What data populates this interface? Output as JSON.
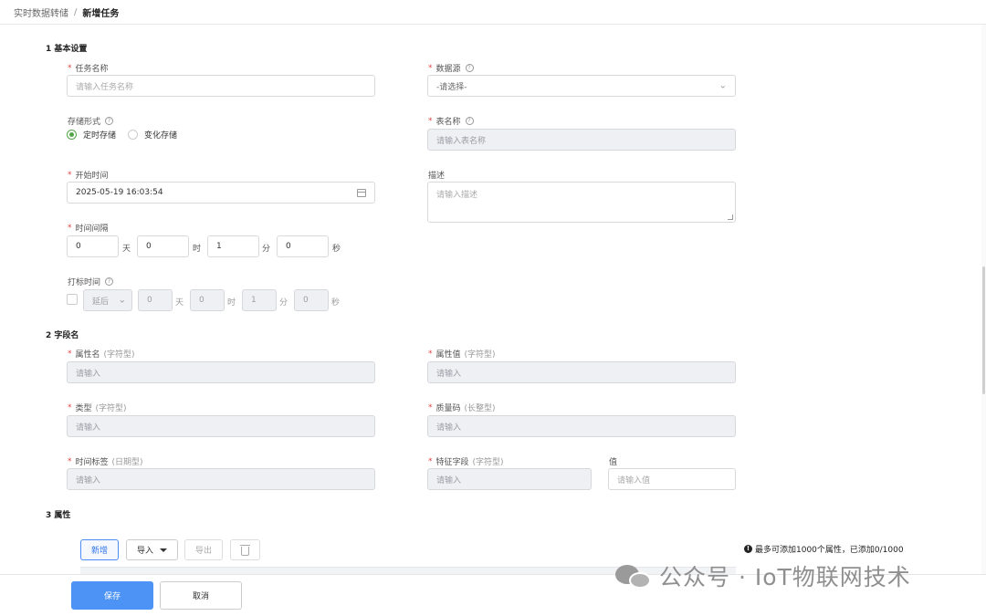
{
  "breadcrumb": {
    "parent": "实时数据转储",
    "separator": "/",
    "current": "新增任务"
  },
  "sections": {
    "basic": "1 基本设置",
    "fields": "2 字段名",
    "attributes": "3 属性"
  },
  "basic": {
    "task_name": {
      "label": "任务名称",
      "placeholder": "请输入任务名称"
    },
    "data_source": {
      "label": "数据源",
      "value": "-请选择-"
    },
    "storage_mode": {
      "label": "存储形式",
      "options": [
        "定时存储",
        "变化存储"
      ],
      "selected": "定时存储"
    },
    "table_name": {
      "label": "表名称",
      "placeholder": "请输入表名称"
    },
    "start_time": {
      "label": "开始时间",
      "value": "2025-05-19 16:03:54"
    },
    "description": {
      "label": "描述",
      "placeholder": "请输入描述"
    },
    "interval": {
      "label": "时间间隔",
      "days": "0",
      "hours": "0",
      "minutes": "1",
      "seconds": "0",
      "unit_day": "天",
      "unit_hour": "时",
      "unit_minute": "分",
      "unit_second": "秒"
    },
    "mark_time": {
      "label": "打标时间",
      "mode": "延后",
      "days": "0",
      "hours": "0",
      "minutes": "1",
      "seconds": "0",
      "unit_day": "天",
      "unit_hour": "时",
      "unit_minute": "分",
      "unit_second": "秒"
    }
  },
  "fields": {
    "attr_name": {
      "label": "属性名",
      "type": "(字符型)",
      "placeholder": "请输入"
    },
    "attr_value": {
      "label": "属性值",
      "type": "(字符型)",
      "placeholder": "请输入"
    },
    "type": {
      "label": "类型",
      "type": "(字符型)",
      "placeholder": "请输入"
    },
    "quality": {
      "label": "质量码",
      "type": "(长整型)",
      "placeholder": "请输入"
    },
    "timestamp": {
      "label": "时间标签",
      "type": "(日期型)",
      "placeholder": "请输入"
    },
    "feature": {
      "label": "特征字段",
      "type": "(字符型)",
      "placeholder": "请输入"
    },
    "value": {
      "label": "值",
      "placeholder": "请输入值"
    }
  },
  "attributes": {
    "add_label": "新增",
    "import_label": "导入",
    "export_label": "导出",
    "limit_note": "最多可添加1000个属性，已添加0/1000"
  },
  "footer": {
    "save_label": "保存",
    "cancel_label": "取消"
  },
  "watermark": {
    "text": "公众号 · IoT物联网技术"
  },
  "icons": {
    "help": "question-circle-icon",
    "calendar": "calendar-icon",
    "chevron": "chevron-down-icon",
    "trash": "trash-icon",
    "info": "info-circle-icon"
  },
  "colors": {
    "accent": "#4c93f5",
    "required": "#e54545",
    "radio_on": "#52a447"
  }
}
